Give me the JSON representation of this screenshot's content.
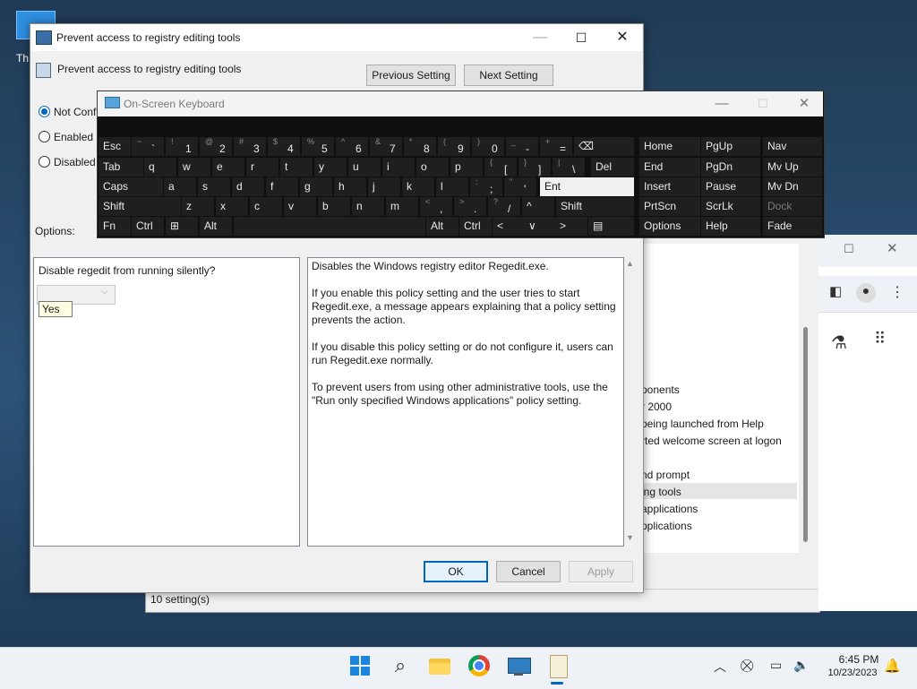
{
  "desktop": {
    "icon_label": "Th"
  },
  "background_window": {
    "list_items": [
      "ponents",
      "r 2000",
      "being launched from Help",
      "rted welcome screen at logon",
      "nd prompt",
      "ing tools",
      "applications",
      "pplications"
    ],
    "status": "10 setting(s)"
  },
  "dialog": {
    "title": "Prevent access to registry editing tools",
    "subtitle": "Prevent access to registry editing tools",
    "prev_button": "Previous Setting",
    "next_button": "Next Setting",
    "radios": [
      {
        "label": "Not Conf",
        "selected": true
      },
      {
        "label": "Enabled",
        "selected": false
      },
      {
        "label": "Disabled",
        "selected": false
      }
    ],
    "options_label": "Options:",
    "option_question": "Disable regedit from running silently?",
    "option_tooltip": "Yes",
    "help_text": "Disables the Windows registry editor Regedit.exe.\n\nIf you enable this policy setting and the user tries to start Regedit.exe, a message appears explaining that a policy setting prevents the action.\n\nIf you disable this policy setting or do not configure it, users can run Regedit.exe normally.\n\nTo prevent users from using other administrative tools, use the \"Run only specified Windows applications\" policy setting.",
    "ok_button": "OK",
    "cancel_button": "Cancel",
    "apply_button": "Apply"
  },
  "osk": {
    "title": "On-Screen Keyboard",
    "rows": [
      [
        {
          "k": "Esc"
        },
        {
          "s": "~",
          "m": "`"
        },
        {
          "s": "!",
          "m": "1"
        },
        {
          "s": "@",
          "m": "2"
        },
        {
          "s": "#",
          "m": "3"
        },
        {
          "s": "$",
          "m": "4"
        },
        {
          "s": "%",
          "m": "5"
        },
        {
          "s": "^",
          "m": "6"
        },
        {
          "s": "&",
          "m": "7"
        },
        {
          "s": "*",
          "m": "8"
        },
        {
          "s": "(",
          "m": "9"
        },
        {
          "s": ")",
          "m": "0"
        },
        {
          "s": "_",
          "m": "-"
        },
        {
          "s": "+",
          "m": "="
        },
        {
          "k": "⌫"
        }
      ],
      [
        {
          "k": "Tab"
        },
        {
          "k": "q"
        },
        {
          "k": "w"
        },
        {
          "k": "e"
        },
        {
          "k": "r"
        },
        {
          "k": "t"
        },
        {
          "k": "y"
        },
        {
          "k": "u"
        },
        {
          "k": "i"
        },
        {
          "k": "o"
        },
        {
          "k": "p"
        },
        {
          "s": "{",
          "m": "["
        },
        {
          "s": "}",
          "m": "]"
        },
        {
          "s": "|",
          "m": "\\"
        },
        {
          "k": "Del"
        }
      ],
      [
        {
          "k": "Caps"
        },
        {
          "k": "a"
        },
        {
          "k": "s"
        },
        {
          "k": "d"
        },
        {
          "k": "f"
        },
        {
          "k": "g"
        },
        {
          "k": "h"
        },
        {
          "k": "j"
        },
        {
          "k": "k"
        },
        {
          "k": "l"
        },
        {
          "s": ":",
          "m": ";"
        },
        {
          "s": "\"",
          "m": "'"
        },
        {
          "k": "Ent"
        }
      ],
      [
        {
          "k": "Shift"
        },
        {
          "k": "z"
        },
        {
          "k": "x"
        },
        {
          "k": "c"
        },
        {
          "k": "v"
        },
        {
          "k": "b"
        },
        {
          "k": "n"
        },
        {
          "k": "m"
        },
        {
          "s": "<",
          "m": ","
        },
        {
          "s": ">",
          "m": "."
        },
        {
          "s": "?",
          "m": "/"
        },
        {
          "k": "^"
        },
        {
          "k": "Shift"
        }
      ],
      [
        {
          "k": "Fn"
        },
        {
          "k": "Ctrl"
        },
        {
          "k": "⊞"
        },
        {
          "k": "Alt"
        },
        {
          "k": ""
        },
        {
          "k": "Alt"
        },
        {
          "k": "Ctrl"
        },
        {
          "k": "<"
        },
        {
          "k": "∨"
        },
        {
          "k": ">"
        },
        {
          "k": "▤"
        }
      ]
    ],
    "nav": [
      [
        "Home",
        "PgUp",
        "Nav"
      ],
      [
        "End",
        "PgDn",
        "Mv Up"
      ],
      [
        "Insert",
        "Pause",
        "Mv Dn"
      ],
      [
        "PrtScn",
        "ScrLk",
        "Dock"
      ],
      [
        "Options",
        "Help",
        "Fade"
      ]
    ]
  },
  "taskbar": {
    "time": "6:45 PM",
    "date": "10/23/2023"
  },
  "icons": [
    "windows-start-icon",
    "search-icon",
    "file-explorer-icon",
    "chrome-icon",
    "remote-desktop-icon",
    "notepad-icon",
    "chevron-up-icon",
    "network-icon",
    "display-icon",
    "volume-icon",
    "notification-bell-icon"
  ]
}
